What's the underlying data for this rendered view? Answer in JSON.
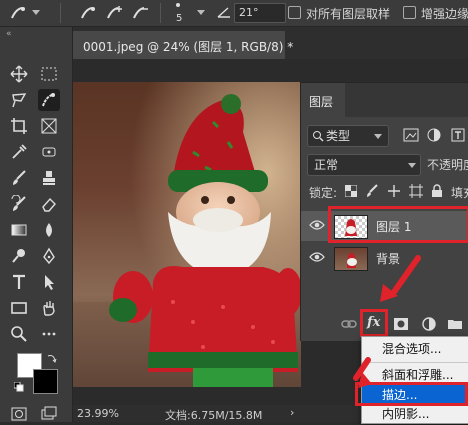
{
  "options_bar": {
    "brush_size": "5",
    "angle_value": "21°",
    "sample_all_layers_label": "对所有图层取样",
    "enhance_edge_label": "增强边缘"
  },
  "document": {
    "tab_title": "0001.jpeg @ 24% (图层 1, RGB/8) *",
    "tab_close": "×"
  },
  "status_bar": {
    "zoom": "23.99%",
    "doc_info": "文档:6.75M/15.8M",
    "arrow": "›"
  },
  "layers_panel": {
    "title": "图层",
    "filter_label": "类型",
    "blend_mode": "正常",
    "opacity_label": "不透明度",
    "lock_label": "锁定:",
    "fill_label": "填充",
    "layers": [
      {
        "name": "图层 1",
        "selected": true
      },
      {
        "name": "背景",
        "selected": false
      }
    ],
    "fx_label": "fx"
  },
  "context_menu": {
    "items": [
      "混合选项...",
      "斜面和浮雕...",
      "描边...",
      "内阴影..."
    ],
    "highlighted_index": 2
  },
  "colors": {
    "highlight_red": "#e0232a",
    "menu_highlight": "#0a64d2"
  }
}
